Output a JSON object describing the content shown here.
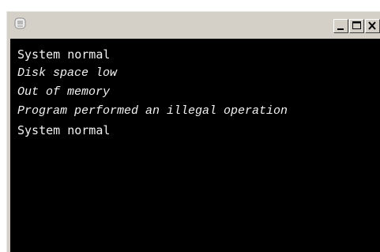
{
  "window": {
    "title": "",
    "icons": {
      "system": "console-app-icon",
      "minimize": "minimize-icon",
      "maximize": "maximize-icon",
      "close": "close-icon"
    }
  },
  "colors": {
    "console_background": "#000000",
    "console_text": "#f2f2f2",
    "frame": "#d4d0c8"
  },
  "console": {
    "lines": [
      {
        "text": "System normal",
        "style": "normal"
      },
      {
        "text": "Disk space low",
        "style": "italic"
      },
      {
        "text": "Out of memory",
        "style": "italic"
      },
      {
        "text": "Program performed an illegal operation",
        "style": "italic"
      },
      {
        "text": "System normal",
        "style": "normal"
      }
    ]
  }
}
